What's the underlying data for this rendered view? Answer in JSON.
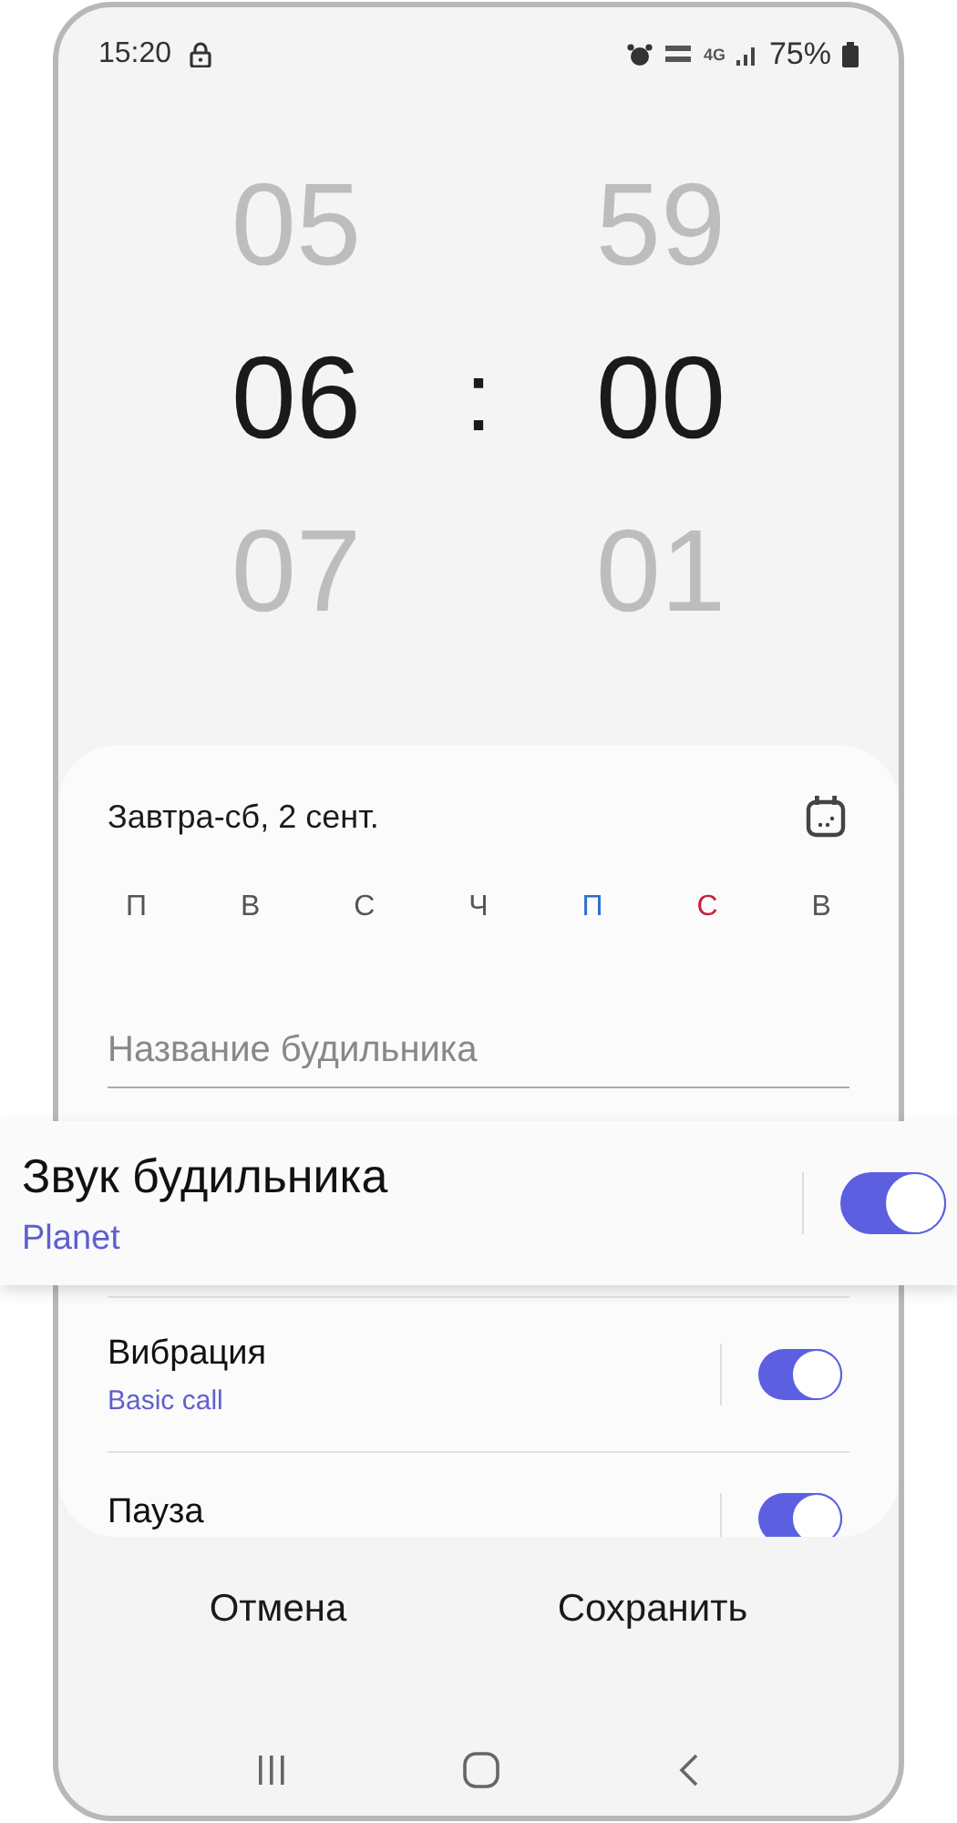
{
  "status_bar": {
    "time": "15:20",
    "network": "4G",
    "battery": "75%"
  },
  "time_picker": {
    "hours": [
      "05",
      "06",
      "07"
    ],
    "separator": ":",
    "minutes": [
      "59",
      "00",
      "01"
    ]
  },
  "alarm": {
    "date": "Завтра-сб, 2 сент.",
    "weekdays": [
      {
        "label": "П",
        "color": "#555555"
      },
      {
        "label": "В",
        "color": "#555555"
      },
      {
        "label": "С",
        "color": "#555555"
      },
      {
        "label": "Ч",
        "color": "#555555"
      },
      {
        "label": "П",
        "color": "#2f6fd1"
      },
      {
        "label": "С",
        "color": "#c8203c"
      },
      {
        "label": "В",
        "color": "#555555"
      }
    ],
    "name_field": {
      "placeholder": "Название будильника"
    },
    "settings": [
      {
        "title": "Звук будильника",
        "subtitle": "Planet",
        "on": true,
        "highlighted": true
      },
      {
        "title": "Вибрация",
        "subtitle": "Basic call",
        "on": true,
        "highlighted": false
      },
      {
        "title": "Пауза",
        "on": true,
        "highlighted": false
      }
    ]
  },
  "buttons": [
    "Отмена",
    "Сохранить"
  ]
}
